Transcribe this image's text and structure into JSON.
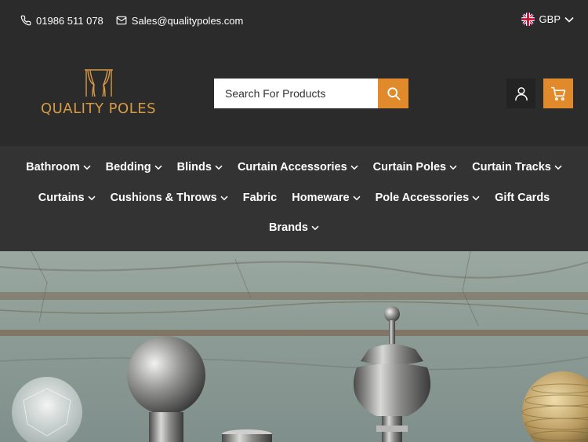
{
  "topbar": {
    "phone": "01986 511 078",
    "email": "Sales@qualitypoles.com",
    "currency": "GBP",
    "icons": {
      "phone": "phone-icon",
      "email": "mail-icon",
      "flag": "uk-flag-icon",
      "chevron": "chevron-down-icon"
    }
  },
  "header": {
    "logo_text": "QUALITY POLES",
    "search": {
      "placeholder": "Search For Products"
    },
    "icons": {
      "search": "search-icon",
      "account": "user-icon",
      "cart": "cart-icon"
    }
  },
  "nav": {
    "row1": [
      "Bathroom",
      "Bedding",
      "Blinds",
      "Curtain Accessories",
      "Curtain Poles",
      "Curtain Tracks"
    ],
    "row2": [
      "Curtains",
      "Cushions & Throws",
      "Fabric",
      "Homeware",
      "Pole Accessories",
      "Gift Cards"
    ],
    "row3": [
      "Brands"
    ]
  },
  "colors": {
    "accent": "#e08a2c",
    "logo_gold": "#d69a45",
    "topbar_bg": "#2b2b2b",
    "nav_bg": "#333333"
  }
}
